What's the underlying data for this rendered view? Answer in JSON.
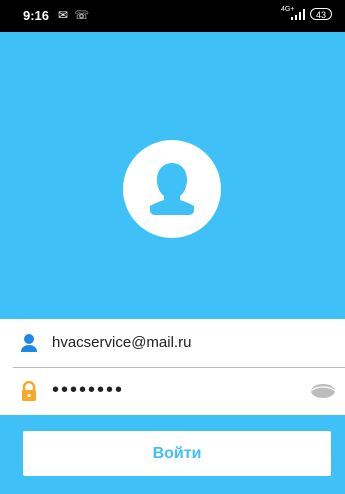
{
  "status_bar": {
    "time": "9:16",
    "network": "4G+",
    "battery": "43",
    "icons": [
      "message-icon",
      "phone-call-icon",
      "signal-icon",
      "battery-icon"
    ]
  },
  "login": {
    "email_value": "hvacservice@mail.ru",
    "password_value": "••••••••",
    "submit_label": "Войти"
  },
  "colors": {
    "accent": "#3fc1f8",
    "icon_blue": "#1e88e5",
    "icon_orange": "#f9a825"
  }
}
